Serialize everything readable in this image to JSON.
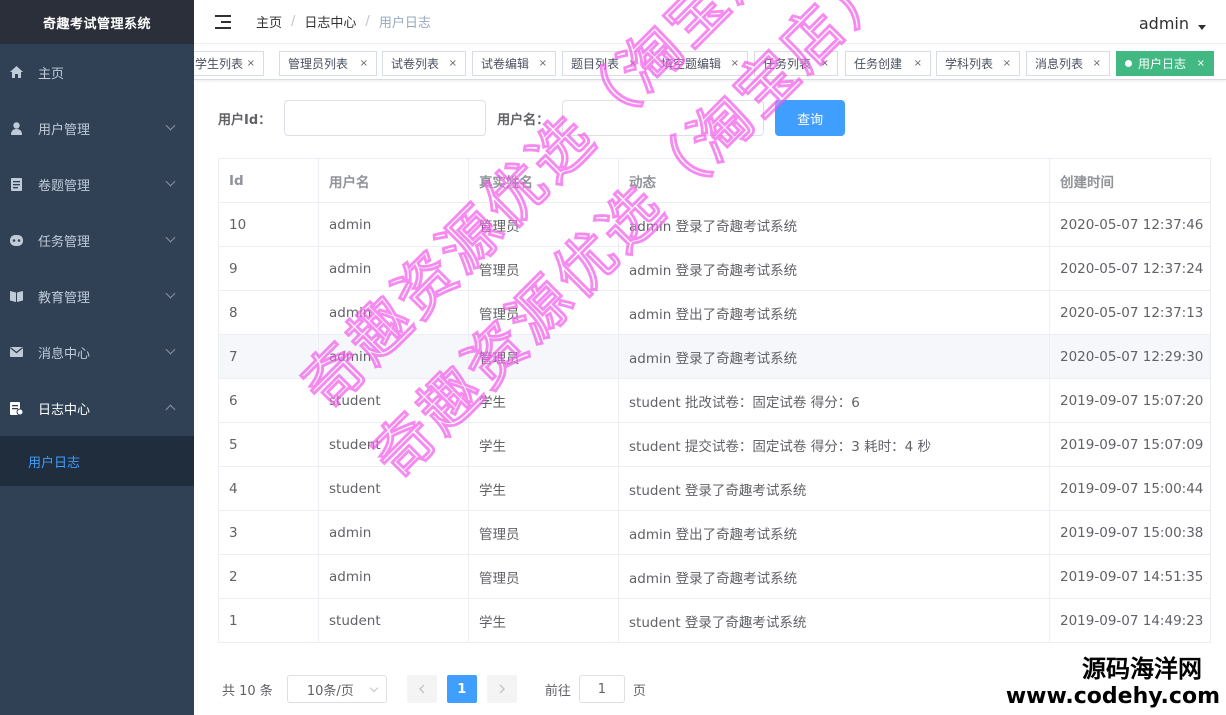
{
  "sidebar": {
    "logo": "奇趣考试管理系统",
    "items": [
      {
        "label": "主页",
        "icon": "home-icon"
      },
      {
        "label": "用户管理",
        "icon": "user-icon"
      },
      {
        "label": "卷题管理",
        "icon": "book-icon"
      },
      {
        "label": "任务管理",
        "icon": "task-icon"
      },
      {
        "label": "教育管理",
        "icon": "education-icon"
      },
      {
        "label": "消息中心",
        "icon": "mail-icon"
      },
      {
        "label": "日志中心",
        "icon": "log-icon"
      }
    ],
    "sub_item": "用户日志"
  },
  "navbar": {
    "breadcrumb": [
      "主页",
      "日志中心",
      "用户日志"
    ],
    "user": "admin"
  },
  "tags": [
    "学生列表",
    "管理员列表",
    "试卷列表",
    "试卷编辑",
    "题目列表",
    "填空题编辑",
    "任务列表",
    "任务创建",
    "学科列表",
    "消息列表",
    "用户日志"
  ],
  "tag_close": "×",
  "form": {
    "user_id_label": "用户Id：",
    "user_name_label": "用户名：",
    "query_button": "查询"
  },
  "table": {
    "columns": [
      "Id",
      "用户名",
      "真实姓名",
      "动态",
      "创建时间"
    ],
    "rows": [
      [
        "10",
        "admin",
        "管理员",
        "admin 登录了奇趣考试系统",
        "2020-05-07 12:37:46"
      ],
      [
        "9",
        "admin",
        "管理员",
        "admin 登录了奇趣考试系统",
        "2020-05-07 12:37:24"
      ],
      [
        "8",
        "admin",
        "管理员",
        "admin 登出了奇趣考试系统",
        "2020-05-07 12:37:13"
      ],
      [
        "7",
        "admin",
        "管理员",
        "admin 登录了奇趣考试系统",
        "2020-05-07 12:29:30"
      ],
      [
        "6",
        "student",
        "学生",
        "student 批改试卷：固定试卷 得分：6",
        "2019-09-07 15:07:20"
      ],
      [
        "5",
        "student",
        "学生",
        "student 提交试卷：固定试卷 得分：3 耗时：4 秒",
        "2019-09-07 15:07:09"
      ],
      [
        "4",
        "student",
        "学生",
        "student 登录了奇趣考试系统",
        "2019-09-07 15:00:44"
      ],
      [
        "3",
        "admin",
        "管理员",
        "admin 登出了奇趣考试系统",
        "2019-09-07 15:00:38"
      ],
      [
        "2",
        "admin",
        "管理员",
        "admin 登录了奇趣考试系统",
        "2019-09-07 14:51:35"
      ],
      [
        "1",
        "student",
        "学生",
        "student 登录了奇趣考试系统",
        "2019-09-07 14:49:23"
      ]
    ]
  },
  "pagination": {
    "total": "共 10 条",
    "page_size": "10条/页",
    "current_page": "1",
    "goto_prefix": "前往",
    "goto_value": "1",
    "goto_suffix": "页"
  },
  "watermark": {
    "line1": "奇趣资源优选（淘宝店）",
    "line2": "奇趣资源优选（淘宝店）",
    "corner_cn": "源码海洋网",
    "corner_url": "www.codehy.com"
  },
  "colors": {
    "sidebar_bg": "#304156",
    "accent": "#409eff",
    "active_tag": "#42b983"
  }
}
